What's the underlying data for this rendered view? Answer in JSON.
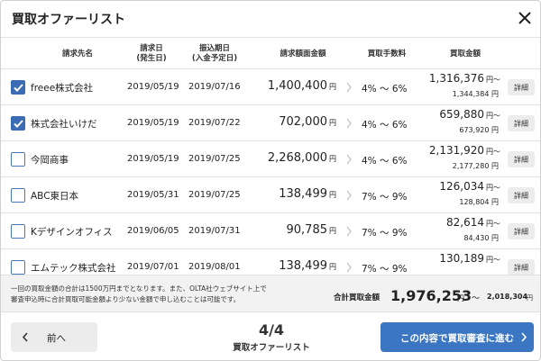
{
  "title": "買取オファーリスト",
  "columns": {
    "invoice_to": "請求先名",
    "invoice_date_1": "請求日",
    "invoice_date_2": "(発生日)",
    "due_date_1": "振込期日",
    "due_date_2": "(入金予定日)",
    "amount": "請求額面金額",
    "fee": "買取手数料",
    "offer": "買取金額"
  },
  "rows": [
    {
      "checked": true,
      "name": "freee株式会社",
      "invoice_date": "2019/05/19",
      "due_date": "2019/07/16",
      "amount": "1,400,400",
      "unit": "円",
      "fee": "4% 〜 6%",
      "offer": "1,316,376",
      "offer_suffix": "円〜",
      "offer_max": "1,344,384 円",
      "detail": "詳細"
    },
    {
      "checked": true,
      "name": "株式会社いけだ",
      "invoice_date": "2019/05/19",
      "due_date": "2019/07/22",
      "amount": "702,000",
      "unit": "円",
      "fee": "4% 〜 6%",
      "offer": "659,880",
      "offer_suffix": "円〜",
      "offer_max": "673,920 円",
      "detail": "詳細"
    },
    {
      "checked": false,
      "name": "今岡商事",
      "invoice_date": "2019/05/19",
      "due_date": "2019/07/25",
      "amount": "2,268,000",
      "unit": "円",
      "fee": "4% 〜 6%",
      "offer": "2,131,920",
      "offer_suffix": "円〜",
      "offer_max": "2,177,280 円",
      "detail": "詳細"
    },
    {
      "checked": false,
      "name": "ABC東日本",
      "invoice_date": "2019/05/31",
      "due_date": "2019/07/25",
      "amount": "138,499",
      "unit": "円",
      "fee": "7% 〜 9%",
      "offer": "126,034",
      "offer_suffix": "円〜",
      "offer_max": "128,804 円",
      "detail": "詳細"
    },
    {
      "checked": false,
      "name": "Kデザインオフィス",
      "invoice_date": "2019/06/05",
      "due_date": "2019/07/31",
      "amount": "90,785",
      "unit": "円",
      "fee": "7% 〜 9%",
      "offer": "82,614",
      "offer_suffix": "円〜",
      "offer_max": "84,430 円",
      "detail": "詳細"
    },
    {
      "checked": false,
      "name": "エムテック株式会社",
      "invoice_date": "2019/07/01",
      "due_date": "2019/08/01",
      "amount": "138,499",
      "unit": "円",
      "fee": "7% 〜 9%",
      "offer": "130,189",
      "offer_suffix": "円〜",
      "offer_max": "",
      "detail": "詳細"
    }
  ],
  "notice": {
    "line1": "一回の買取金額の合計は1500万円までとなります。また、OLTA社ウェブサイト上で",
    "line2": "審査申込時に合計買取可能金額より少ない金額で申し込むことは可能です。",
    "total_label": "合計買取金額",
    "total_value": "1,976,253",
    "total_unit": "円",
    "tilde": "〜",
    "total_max": "2,018,304",
    "total_max_unit": "円"
  },
  "footer": {
    "prev_label": "前へ",
    "page": "4/4",
    "step_label": "買取オファーリスト",
    "next_label": "この内容で買取審査に進む"
  },
  "colors": {
    "accent": "#3b76c2",
    "checkbox": "#3a6db3"
  },
  "icons": {
    "close": "close-icon",
    "check": "check-icon",
    "chevron": "chevron-right-icon",
    "prev": "chevron-left-icon",
    "next": "chevron-right-icon"
  }
}
